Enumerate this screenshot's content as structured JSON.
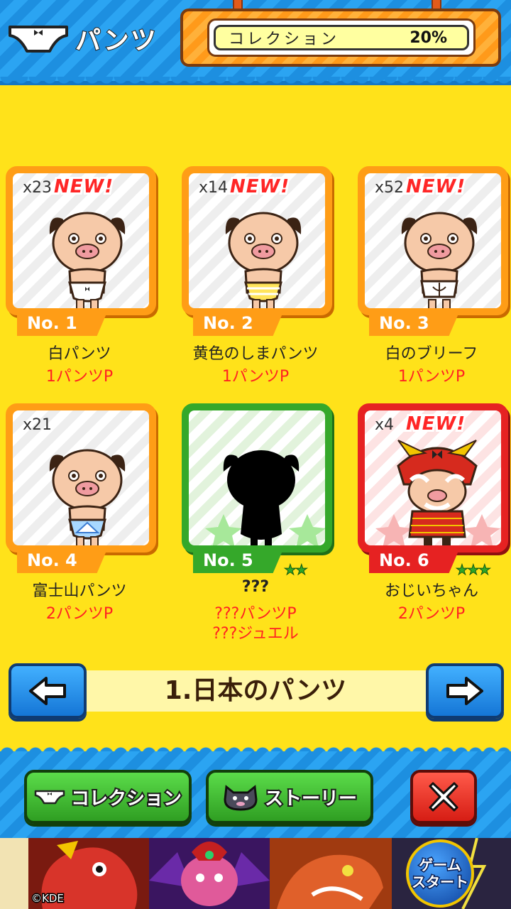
{
  "header": {
    "title": "パンツ",
    "collection_label": "コレクション",
    "collection_percent": "20%"
  },
  "cards": [
    {
      "count": "x23",
      "new_label": "NEW!",
      "number": "No. 1",
      "name": "白パンツ",
      "cost": "1パンツP",
      "stars": "",
      "frame": "orange",
      "pants_color": "#ffffff"
    },
    {
      "count": "x14",
      "new_label": "NEW!",
      "number": "No. 2",
      "name": "黄色のしまパンツ",
      "cost": "1パンツP",
      "stars": "",
      "frame": "orange",
      "pants_color": "#ffe45a"
    },
    {
      "count": "x52",
      "new_label": "NEW!",
      "number": "No. 3",
      "name": "白のブリーフ",
      "cost": "1パンツP",
      "stars": "",
      "frame": "orange",
      "pants_color": "#ffffff"
    },
    {
      "count": "x21",
      "new_label": "",
      "number": "No. 4",
      "name": "富士山パンツ",
      "cost": "2パンツP",
      "stars": "",
      "frame": "orange",
      "pants_color": "#a8d8ff"
    },
    {
      "count": "",
      "new_label": "",
      "number": "No. 5",
      "name": "???",
      "cost": "???パンツP",
      "cost2": "???ジュエル",
      "stars": "★★",
      "frame": "green",
      "pants_color": "#000000"
    },
    {
      "count": "x4",
      "new_label": "NEW!",
      "number": "No. 6",
      "name": "おじいちゃん",
      "cost": "2パンツP",
      "stars": "★★★",
      "frame": "red",
      "pants_color": "#d62a1e"
    }
  ],
  "category": {
    "title": "1.日本のパンツ"
  },
  "buttons": {
    "collection": "コレクション",
    "story": "ストーリー"
  },
  "ad": {
    "copyright": "©KDE",
    "start_line1": "ゲーム",
    "start_line2": "スタート"
  },
  "colors": {
    "background": "#ffe21a",
    "blue": "#1d8fe0",
    "orange": "#ff9d16",
    "green": "#35a82a",
    "red": "#e62222",
    "cost_red": "#ff2222"
  }
}
